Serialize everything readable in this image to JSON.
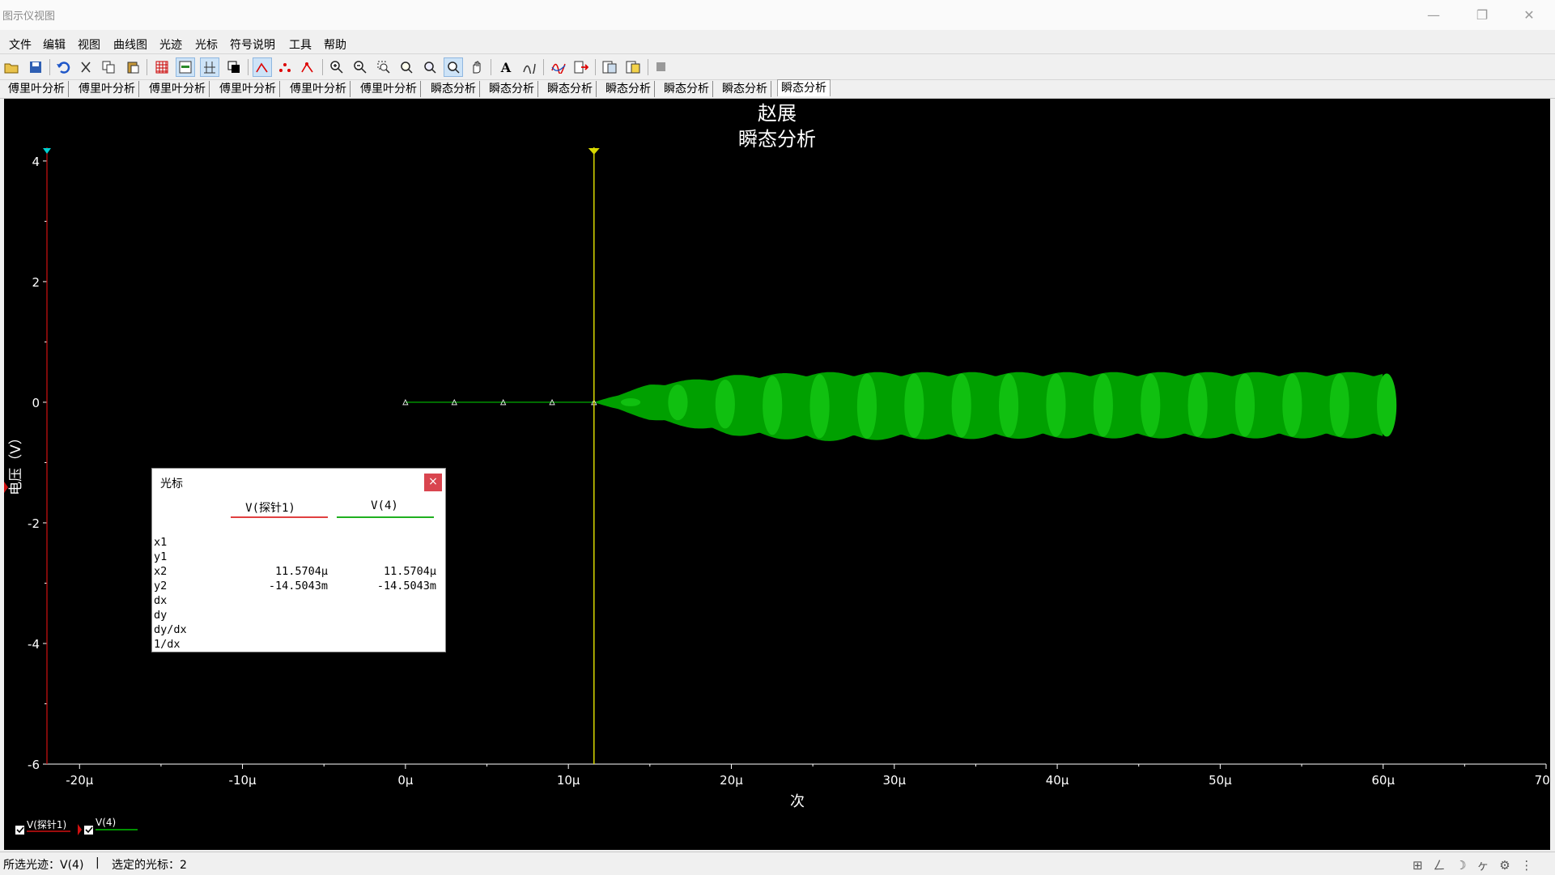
{
  "window": {
    "title": "图示仪视图"
  },
  "menu": [
    "文件",
    "编辑",
    "视图",
    "曲线图",
    "光迹",
    "光标",
    "符号说明",
    "工具",
    "帮助"
  ],
  "toolbar_icons": [
    "open-icon",
    "save-icon",
    "undo-icon",
    "cut-icon",
    "copy-icon",
    "paste-icon",
    "grid-icon",
    "toggle-legend-icon",
    "toggle-cursor-icon",
    "reverse-colors-icon",
    "show-select-marks-icon",
    "show-markers-icon",
    "show-marks-icon",
    "zoom-in-icon",
    "zoom-out-icon",
    "zoom-area-icon",
    "zoom-x-icon",
    "zoom-y-icon",
    "zoom-full-icon",
    "pan-icon",
    "text-icon",
    "label-icon",
    "overlay-traces-icon",
    "export-icon",
    "properties-icon",
    "page-properties-icon",
    "stop-icon"
  ],
  "tabs": [
    "傅里叶分析",
    "傅里叶分析",
    "傅里叶分析",
    "傅里叶分析",
    "傅里叶分析",
    "傅里叶分析",
    "瞬态分析",
    "瞬态分析",
    "瞬态分析",
    "瞬态分析",
    "瞬态分析",
    "瞬态分析",
    "瞬态分析"
  ],
  "plot": {
    "title1": "赵展",
    "title2": "瞬态分析",
    "xlabel": "次",
    "ylabel": "电压（V）",
    "xticks": [
      "-20μ",
      "-10μ",
      "0μ",
      "10μ",
      "20μ",
      "30μ",
      "40μ",
      "50μ",
      "60μ",
      "70μ"
    ],
    "yticks": [
      "4",
      "2",
      "0",
      "-2",
      "-4",
      "-6"
    ],
    "legend": [
      "V(探针1)",
      "V(4)"
    ],
    "colors": {
      "probe1": "#d01010",
      "v4": "#00c000",
      "cursor": "#d8d800",
      "background": "#000000"
    }
  },
  "chart_data": {
    "type": "line",
    "title": "瞬态分析",
    "xlabel": "次",
    "ylabel": "电压（V）",
    "xlim": [
      -22,
      70
    ],
    "ylim": [
      -6,
      4.2
    ],
    "series": [
      {
        "name": "V(探针1)",
        "x": [
          -22,
          -22
        ],
        "y": [
          -6,
          4.2
        ]
      },
      {
        "name": "V(4)",
        "x": [
          0,
          3,
          6,
          9,
          11.57,
          15,
          20,
          25,
          30,
          40,
          50,
          60
        ],
        "envelope_upper": [
          0,
          0,
          0,
          0,
          0,
          0.3,
          0.45,
          0.5,
          0.5,
          0.5,
          0.5,
          0.5
        ],
        "envelope_lower": [
          0,
          0,
          0,
          0,
          0,
          -0.3,
          -0.55,
          -0.65,
          -0.62,
          -0.6,
          -0.6,
          -0.6
        ]
      }
    ],
    "cursors": {
      "cursor1_x": -22,
      "cursor2_x": 11.5704
    }
  },
  "cursor_panel": {
    "title": "光标",
    "close": "×",
    "col1": "V(探针1)",
    "col2": "V(4)",
    "rows": [
      {
        "label": "x1",
        "v1": "",
        "v2": ""
      },
      {
        "label": "y1",
        "v1": "",
        "v2": ""
      },
      {
        "label": "x2",
        "v1": "11.5704μ",
        "v2": "11.5704μ"
      },
      {
        "label": "y2",
        "v1": "-14.5043m",
        "v2": "-14.5043m"
      },
      {
        "label": "dx",
        "v1": "",
        "v2": ""
      },
      {
        "label": "dy",
        "v1": "",
        "v2": ""
      },
      {
        "label": "dy/dx",
        "v1": "",
        "v2": ""
      },
      {
        "label": "1/dx",
        "v1": "",
        "v2": ""
      }
    ]
  },
  "status": {
    "selected_trace": "所选光迹：V(4)",
    "sep": "|",
    "selected_cursor": "选定的光标：2"
  }
}
